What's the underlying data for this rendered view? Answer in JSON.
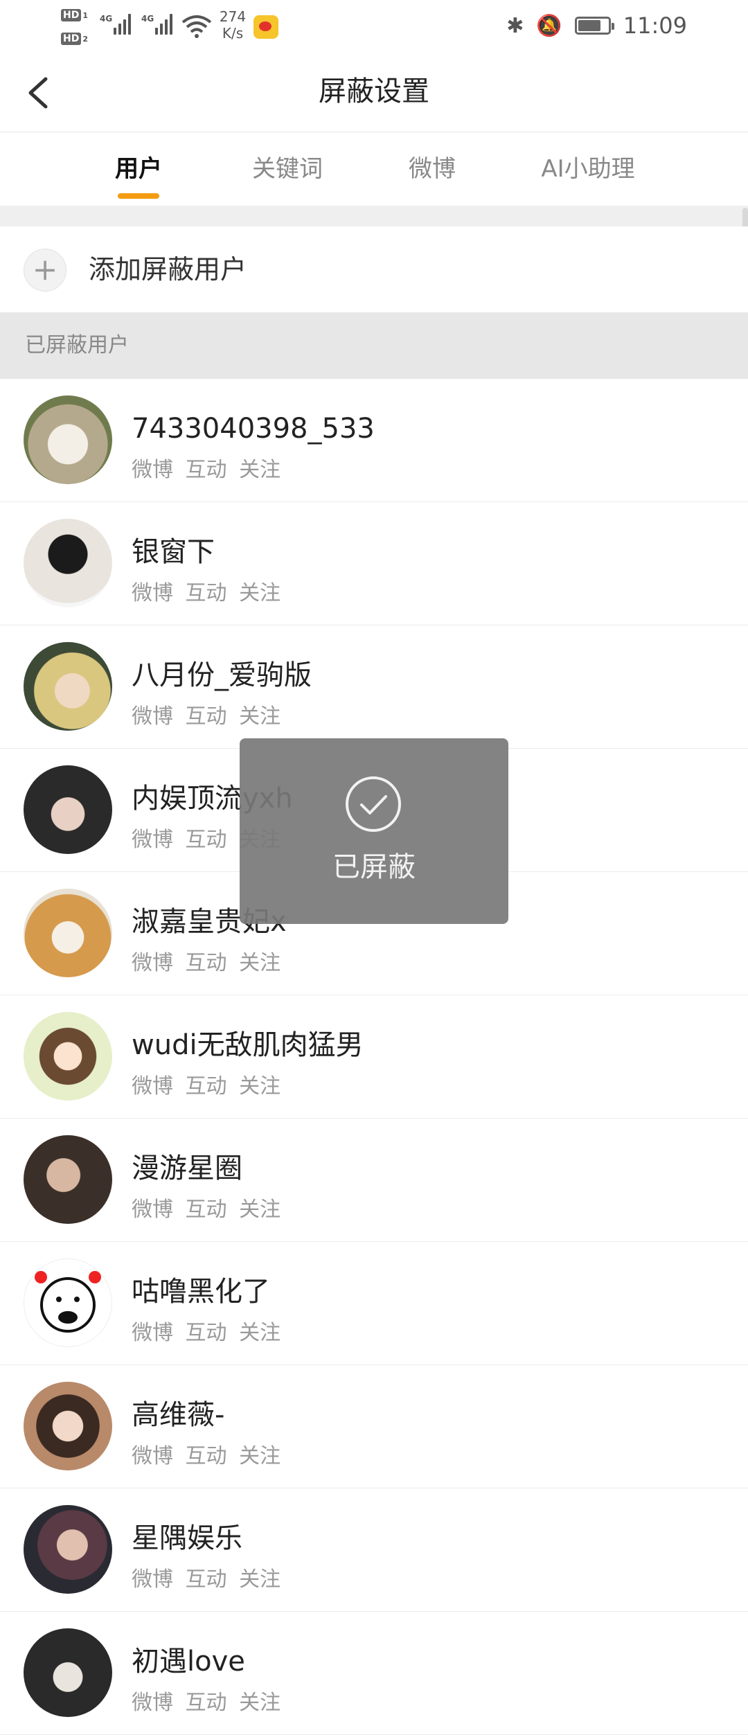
{
  "status_bar": {
    "hd1": "HD",
    "hd1_sub": "1",
    "hd2": "HD",
    "hd2_sub": "2",
    "net1": "4G",
    "net2": "4G",
    "speed_value": "274",
    "speed_unit": "K/s",
    "time": "11:09",
    "icons": [
      "wifi-icon",
      "weibo-app-icon",
      "bluetooth-icon",
      "bell-off-icon",
      "battery-charging-icon"
    ]
  },
  "header": {
    "title": "屏蔽设置",
    "back_icon": "chevron-left-icon"
  },
  "tabs": [
    {
      "label": "用户",
      "active": true
    },
    {
      "label": "关键词",
      "active": false
    },
    {
      "label": "微博",
      "active": false
    },
    {
      "label": "AI小助理",
      "active": false
    }
  ],
  "add_user": {
    "icon": "plus-icon",
    "label": "添加屏蔽用户"
  },
  "section": {
    "title": "已屏蔽用户"
  },
  "colors": {
    "accent": "#f39c12",
    "divider": "#ececec",
    "section_bg": "#e7e7e7"
  },
  "users": [
    {
      "name": "7433040398_533",
      "sub": [
        "微博",
        "互动",
        "关注"
      ],
      "avatar_color": "#c9c0a8"
    },
    {
      "name": "银窗下",
      "sub": [
        "微博",
        "互动",
        "关注"
      ],
      "avatar_color": "#e9e9e9"
    },
    {
      "name": "八月份_爱驹版",
      "sub": [
        "微博",
        "互动",
        "关注"
      ],
      "avatar_color": "#d7c98a"
    },
    {
      "name": "内娱顶流yxh",
      "sub": [
        "微博",
        "互动",
        "关注"
      ],
      "avatar_color": "#2c2c2c"
    },
    {
      "name": "淑嘉皇贵妃x",
      "sub": [
        "微博",
        "互动",
        "关注"
      ],
      "avatar_color": "#d69a4d"
    },
    {
      "name": "wudi无敌肌肉猛男",
      "sub": [
        "微博",
        "互动",
        "关注"
      ],
      "avatar_color": "#e6efc9"
    },
    {
      "name": "漫游星圈",
      "sub": [
        "微博",
        "互动",
        "关注"
      ],
      "avatar_color": "#3a3029"
    },
    {
      "name": "咕噜黑化了",
      "sub": [
        "微博",
        "互动",
        "关注"
      ],
      "avatar_color": "#ffffff"
    },
    {
      "name": "高维薇-",
      "sub": [
        "微博",
        "互动",
        "关注"
      ],
      "avatar_color": "#b88a6a"
    },
    {
      "name": "星隅娱乐",
      "sub": [
        "微博",
        "互动",
        "关注"
      ],
      "avatar_color": "#3b3b45"
    },
    {
      "name": "初遇love",
      "sub": [
        "微博",
        "互动",
        "关注"
      ],
      "avatar_color": "#2a2a2a"
    }
  ],
  "toast": {
    "icon": "check-circle-icon",
    "text": "已屏蔽"
  }
}
